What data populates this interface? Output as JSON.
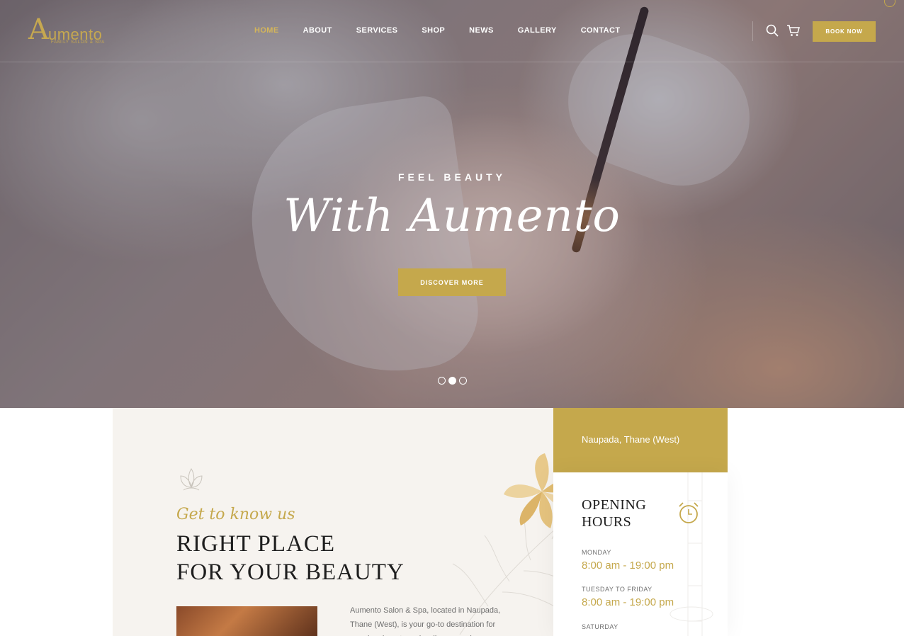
{
  "brand": {
    "logo_letter": "A",
    "logo_text": "umento",
    "logo_tagline": "FAMILY SALON & SPA",
    "accent": "#c5a84c"
  },
  "nav": {
    "items": [
      "HOME",
      "ABOUT",
      "SERVICES",
      "SHOP",
      "NEWS",
      "GALLERY",
      "CONTACT"
    ],
    "active": "HOME"
  },
  "header": {
    "book_label": "BOOK NOW",
    "icons": [
      "search-icon",
      "cart-icon"
    ]
  },
  "hero": {
    "kicker": "FEEL BEAUTY",
    "title": "With Aumento",
    "cta_label": "DISCOVER MORE",
    "slides": 3,
    "active_slide": 2
  },
  "about": {
    "script": "Get to know us",
    "title_line1": "RIGHT PLACE",
    "title_line2": "FOR YOUR BEAUTY",
    "text": "Aumento Salon & Spa, located in Naupada, Thane (West), is your go-to destination for premium beauty and wellness services."
  },
  "location": {
    "label": "Naupada, Thane (West)"
  },
  "hours": {
    "title_line1": "OPENING",
    "title_line2": "HOURS",
    "rows": [
      {
        "day": "MONDAY",
        "time": "8:00 am - 19:00 pm"
      },
      {
        "day": "TUESDAY TO FRIDAY",
        "time": "8:00 am - 19:00 pm"
      },
      {
        "day": "SATURDAY",
        "time": ""
      }
    ]
  }
}
